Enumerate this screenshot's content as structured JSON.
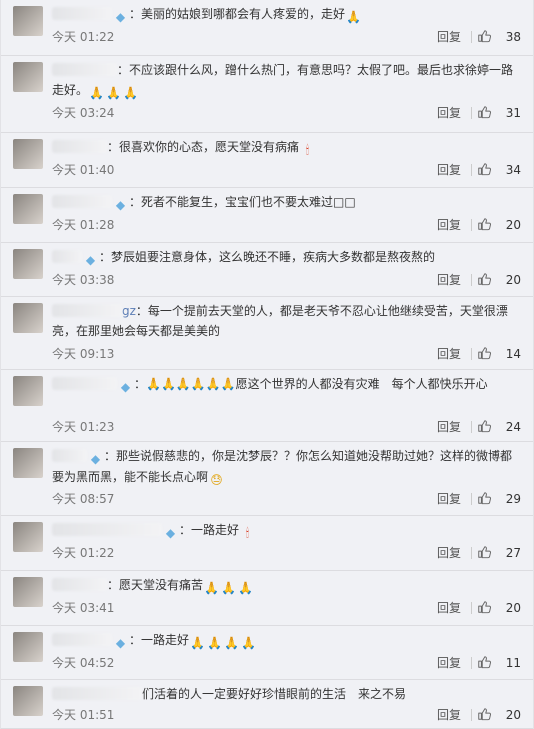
{
  "actions": {
    "reply_label": "回复"
  },
  "comments": [
    {
      "user_suffix": "",
      "text": "：美丽的姑娘到哪都会有人疼爱的，走好",
      "emojis_after": [
        "🙏"
      ],
      "time": "今天 01:22",
      "likes": "38"
    },
    {
      "user_suffix": "",
      "text": "：不应该跟什么风，蹭什么热门，有意思吗？太假了吧。最后也求徐婷一路走好。",
      "emojis_after": [
        "🙏",
        "🙏",
        "🙏"
      ],
      "time": "今天 03:24",
      "likes": "31"
    },
    {
      "user_suffix": "",
      "text": "：很喜欢你的心态，愿天堂没有病痛",
      "emojis_after": [
        "🕯"
      ],
      "time": "今天 01:40",
      "likes": "34"
    },
    {
      "user_suffix": "",
      "text": "：死者不能复生，宝宝们也不要太难过□□",
      "emojis_after": [],
      "time": "今天 01:28",
      "likes": "20"
    },
    {
      "user_suffix": "",
      "text": "：梦辰姐要注意身体，这么晚还不睡，疾病大多数都是熬夜熬的",
      "emojis_after": [],
      "time": "今天 03:38",
      "likes": "20"
    },
    {
      "user_suffix": "gz",
      "text": "：每一个提前去天堂的人，都是老天爷不忍心让他继续受苦，天堂很漂亮，在那里她会每天都是美美的",
      "emojis_after": [],
      "time": "今天 09:13",
      "likes": "14"
    },
    {
      "user_suffix": "",
      "text": "：🙏🙏🙏🙏🙏🙏愿这个世界的人都没有灾难　每个人都快乐开心",
      "emojis_after": [],
      "time": "今天 01:23",
      "likes": "24"
    },
    {
      "user_suffix": "",
      "text": "：那些说假慈悲的，你是沈梦辰？？你怎么知道她没帮助过她？这样的微博都要为黑而黑，能不能长点心啊",
      "emojis_after": [
        "😓"
      ],
      "time": "今天 08:57",
      "likes": "29"
    },
    {
      "user_suffix": "",
      "text": "：一路走好",
      "emojis_after": [
        "🕯"
      ],
      "time": "今天 01:22",
      "likes": "27"
    },
    {
      "user_suffix": "",
      "text": "：愿天堂没有痛苦",
      "emojis_after": [
        "🙏",
        "🙏",
        "🙏"
      ],
      "time": "今天 03:41",
      "likes": "20"
    },
    {
      "user_suffix": "",
      "text": "：一路走好",
      "emojis_after": [
        "🙏",
        "🙏",
        "🙏",
        "🙏"
      ],
      "time": "今天 04:52",
      "likes": "11"
    },
    {
      "user_suffix": "",
      "text": "们活着的人一定要好好珍惜眼前的生活　来之不易",
      "emojis_after": [],
      "time": "今天 01:51",
      "likes": "20"
    }
  ]
}
